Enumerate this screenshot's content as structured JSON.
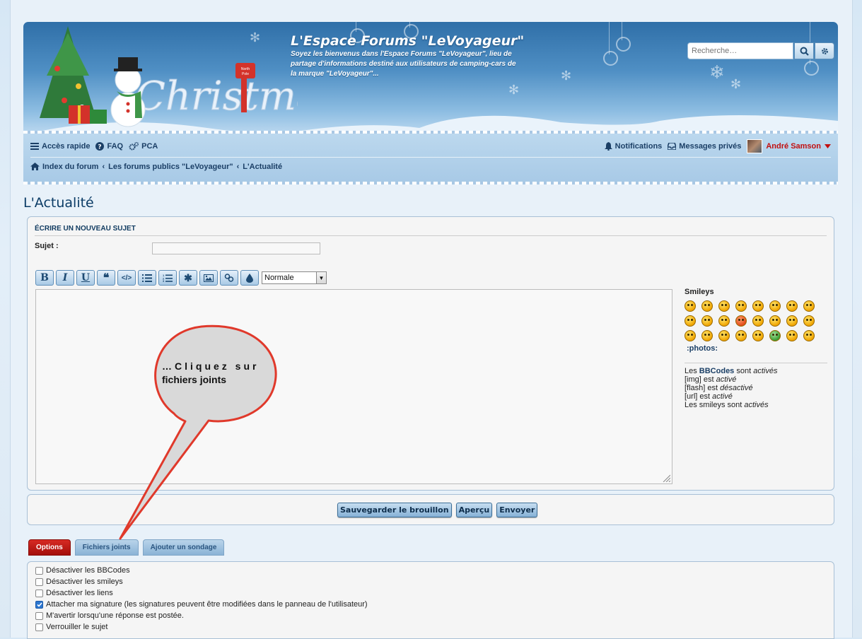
{
  "header": {
    "title": "L'Espace Forums \"LeVoyageur\"",
    "description": "Soyez les bienvenus dans l'Espace Forums \"LeVoyageur\", lieu de partage d'informations destiné aux utilisateurs de camping-cars de la marque \"LeVoyageur\"...",
    "search_placeholder": "Recherche…"
  },
  "nav": {
    "quick_access": "Accès rapide",
    "faq": "FAQ",
    "pca": "PCA",
    "notifications": "Notifications",
    "private_messages": "Messages privés",
    "username": "André Samson"
  },
  "breadcrumb": {
    "items": [
      "Index du forum",
      "Les forums publics \"LeVoyageur\"",
      "L'Actualité"
    ]
  },
  "page": {
    "title": "L'Actualité",
    "panel_title": "ÉCRIRE UN NOUVEAU SUJET",
    "subject_label": "Sujet :",
    "subject_value": ""
  },
  "editor": {
    "font_size": "Normale",
    "toolbar_icons": [
      "bold-icon",
      "italic-icon",
      "underline-icon",
      "quote-icon",
      "code-icon",
      "list-icon",
      "numbered-list-icon",
      "list-item-icon",
      "image-icon",
      "link-icon",
      "color-icon"
    ]
  },
  "smileys": {
    "title": "Smileys",
    "more_link": ":photos:"
  },
  "bbcode": {
    "line1_pre": "Les ",
    "line1_link": "BBCodes",
    "line1_mid": " sont ",
    "line1_state": "activés",
    "line2_pre": "[img] est ",
    "line2_state": "activé",
    "line3_pre": "[flash] est ",
    "line3_state": "désactivé",
    "line4_pre": "[url] est ",
    "line4_state": "activé",
    "line5_pre": "Les smileys sont ",
    "line5_state": "activés"
  },
  "actions": {
    "save_draft": "Sauvegarder le brouillon",
    "preview": "Aperçu",
    "submit": "Envoyer"
  },
  "tabs": [
    "Options",
    "Fichiers joints",
    "Ajouter un sondage"
  ],
  "options": [
    {
      "label": "Désactiver les BBCodes",
      "checked": false
    },
    {
      "label": "Désactiver les smileys",
      "checked": false
    },
    {
      "label": "Désactiver les liens",
      "checked": false
    },
    {
      "label": "Attacher ma signature (les signatures peuvent être modifiées dans le panneau de l'utilisateur)",
      "checked": true
    },
    {
      "label": "M'avertir lorsqu'une réponse est postée.",
      "checked": false
    },
    {
      "label": "Verrouiller le sujet",
      "checked": false
    }
  ],
  "callout": {
    "line1": "…Cliquez sur",
    "line2": "fichiers joints"
  },
  "colors": {
    "accent": "#1b3f66",
    "active_tab": "#c41b16",
    "username": "#c20f0f"
  }
}
